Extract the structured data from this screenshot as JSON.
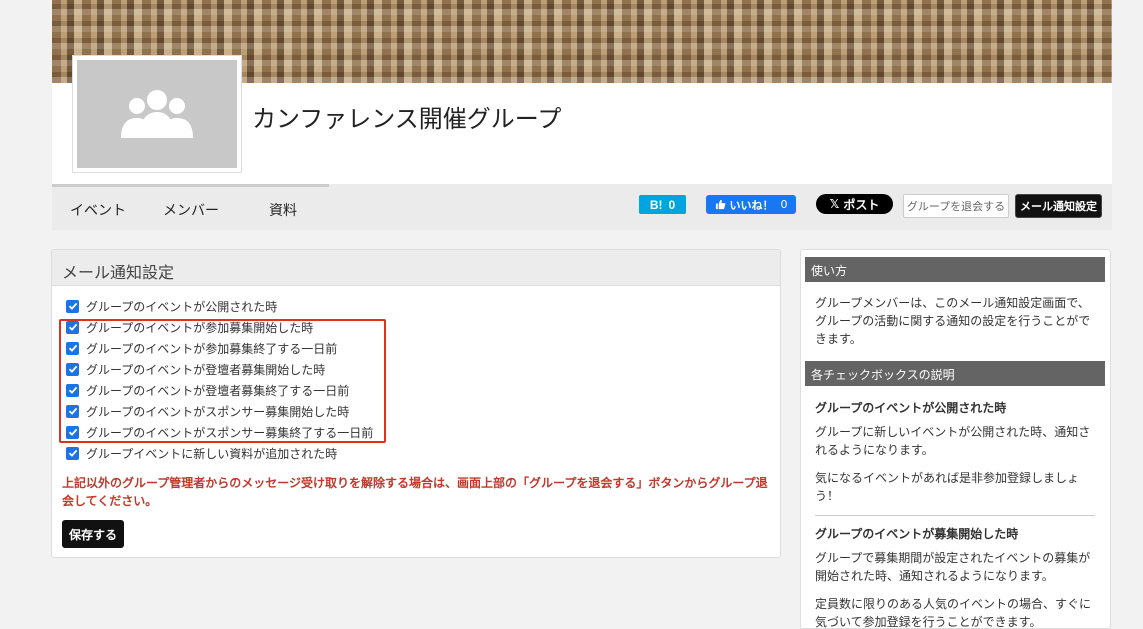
{
  "group": {
    "title": "カンファレンス開催グループ"
  },
  "nav": {
    "tabs": [
      "イベント",
      "メンバー",
      "資料"
    ]
  },
  "social": {
    "hatena_label": "B!",
    "hatena_count": "0",
    "fb_label": "いいね！",
    "fb_count": "0",
    "x_label": "ポスト"
  },
  "actions": {
    "leave_label": "グループを退会する",
    "mail_settings_label": "メール通知設定"
  },
  "settings": {
    "title": "メール通知設定",
    "checkboxes": [
      "グループのイベントが公開された時",
      "グループのイベントが参加募集開始した時",
      "グループのイベントが参加募集終了する一日前",
      "グループのイベントが登壇者募集開始した時",
      "グループのイベントが登壇者募集終了する一日前",
      "グループのイベントがスポンサー募集開始した時",
      "グループのイベントがスポンサー募集終了する一日前",
      "グループイベントに新しい資料が追加された時"
    ],
    "warning": "上記以外のグループ管理者からのメッセージ受け取りを解除する場合は、画面上部の「グループを退会する」ボタンからグループ退会してください。",
    "save_label": "保存する"
  },
  "sidebar": {
    "howto_title": "使い方",
    "howto_text": "グループメンバーは、このメール通知設定画面で、グループの活動に関する通知の設定を行うことができます。",
    "checkbox_title": "各チェックボックスの説明",
    "item1_title": "グループのイベントが公開された時",
    "item1_text1": "グループに新しいイベントが公開された時、通知されるようになります。",
    "item1_text2": "気になるイベントがあれば是非参加登録しましょう！",
    "item2_title": "グループのイベントが募集開始した時",
    "item2_text1": "グループで募集期間が設定されたイベントの募集が開始された時、通知されるようになります。",
    "item2_text2": "定員数に限りのある人気のイベントの場合、すぐに気づいて参加登録を行うことができます。"
  },
  "colors": {
    "checkbox": "#1a73e8",
    "highlight": "#e0301e",
    "warning": "#c0392b"
  }
}
